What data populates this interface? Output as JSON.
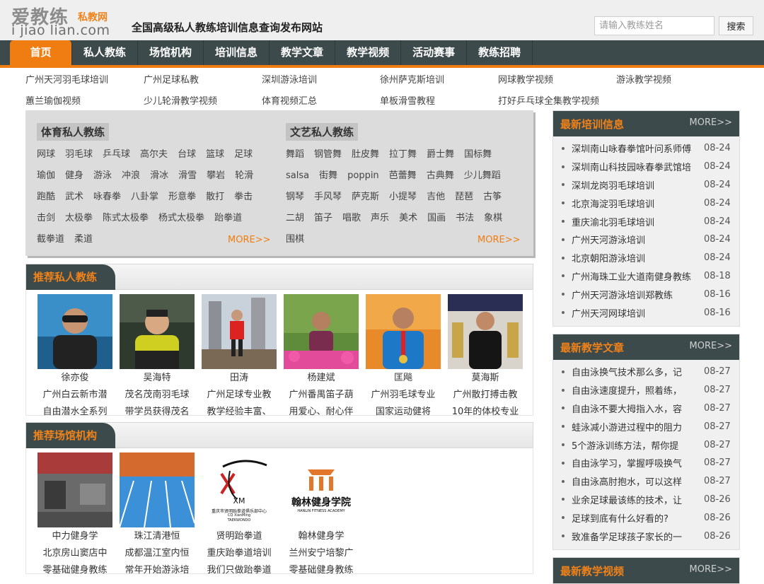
{
  "header": {
    "logo_cn": "爱教练",
    "logo_sub": "私教网",
    "logo_url": "i jiao lian.com",
    "slogan": "全国高级私人教练培训信息查询发布网站",
    "search_placeholder": "请输入教练姓名",
    "search_button": "搜索"
  },
  "nav": {
    "items": [
      "首页",
      "私人教练",
      "场馆机构",
      "培训信息",
      "教学文章",
      "教学视频",
      "活动赛事",
      "教练招聘"
    ]
  },
  "hot_links": [
    "广州天河羽毛球培训",
    "广州足球私教",
    "深圳游泳培训",
    "徐州萨克斯培训",
    "网球教学视频",
    "游泳教学视频",
    "蕙兰瑜伽视频",
    "少儿轮滑教学视频",
    "体育视频汇总",
    "单板滑雪教程",
    "打好乒乓球全集教学视频"
  ],
  "sports": {
    "title": "体育私人教练",
    "tags": [
      "网球",
      "羽毛球",
      "乒乓球",
      "高尔夫",
      "台球",
      "篮球",
      "足球",
      "瑜伽",
      "健身",
      "游泳",
      "冲浪",
      "滑冰",
      "滑雪",
      "攀岩",
      "轮滑",
      "跑酷",
      "武术",
      "咏春拳",
      "八卦掌",
      "形意拳",
      "散打",
      "拳击",
      "击剑",
      "太极拳",
      "陈式太极拳",
      "杨式太极拳",
      "跆拳道",
      "截拳道",
      "柔道"
    ],
    "more": "MORE>>"
  },
  "arts": {
    "title": "文艺私人教练",
    "tags": [
      "舞蹈",
      "钢管舞",
      "肚皮舞",
      "拉丁舞",
      "爵士舞",
      "国标舞",
      "salsa",
      "街舞",
      "poppin",
      "芭蕾舞",
      "古典舞",
      "少儿舞蹈",
      "钢琴",
      "手风琴",
      "萨克斯",
      "小提琴",
      "吉他",
      "琵琶",
      "古筝",
      "二胡",
      "笛子",
      "唱歌",
      "声乐",
      "美术",
      "国画",
      "书法",
      "象棋",
      "围棋"
    ],
    "more": "MORE>>"
  },
  "coaches": {
    "title": "推荐私人教练",
    "items": [
      {
        "name": "徐亦俊",
        "line1": "广州白云新市潜",
        "line2": "自由潜水全系列"
      },
      {
        "name": "吴海特",
        "line1": "茂名茂南羽毛球",
        "line2": "带学员获得茂名"
      },
      {
        "name": "田涛",
        "line1": "广州足球专业教",
        "line2": "教学经验丰富、"
      },
      {
        "name": "杨建斌",
        "line1": "广州番禺笛子葫",
        "line2": "用爱心、耐心伴"
      },
      {
        "name": "匡飚",
        "line1": "广州羽毛球专业",
        "line2": "国家运动健将"
      },
      {
        "name": "莫海斯",
        "line1": "广州散打搏击教",
        "line2": "10年的体校专业"
      }
    ]
  },
  "venues": {
    "title": "推荐场馆机构",
    "items": [
      {
        "name": "中力健身学",
        "line1": "北京房山窦店中",
        "line2": "零基础健身教练"
      },
      {
        "name": "珠江清港恒",
        "line1": "成都温江室内恒",
        "line2": "常年开始游泳培"
      },
      {
        "name": "贤明跆拳道",
        "line1": "重庆跆拳道培训",
        "line2": "我们只做跆拳道"
      },
      {
        "name": "翰林健身学",
        "line1": "兰州安宁培黎广",
        "line2": "零基础健身教练"
      }
    ],
    "logo_xm": "XM",
    "logo_xm_sub": "重庆市贤明跆拳道俱乐部中心",
    "logo_xm_en": "CQ XianMing",
    "logo_xm_en2": "TAEKWONDO",
    "logo_hl": "翰林健身学院",
    "logo_hl_en": "HANLIN FITNESS ACADEMY"
  },
  "training": {
    "title": "最新培训信息",
    "more": "MORE>>",
    "rows": [
      {
        "text": "深圳南山咏春拳馆叶问系师傅",
        "date": "08-24"
      },
      {
        "text": "深圳南山科技园咏春拳武馆培",
        "date": "08-24"
      },
      {
        "text": "深圳龙岗羽毛球培训",
        "date": "08-24"
      },
      {
        "text": "北京海淀羽毛球培训",
        "date": "08-24"
      },
      {
        "text": "重庆渝北羽毛球培训",
        "date": "08-24"
      },
      {
        "text": "广州天河游泳培训",
        "date": "08-24"
      },
      {
        "text": "北京朝阳游泳培训",
        "date": "08-24"
      },
      {
        "text": "广州海珠工业大道南健身教练",
        "date": "08-18"
      },
      {
        "text": "广州天河游泳培训郑教练",
        "date": "08-16"
      },
      {
        "text": "广州天河网球培训",
        "date": "08-16"
      }
    ]
  },
  "articles": {
    "title": "最新教学文章",
    "more": "MORE>>",
    "rows": [
      {
        "text": "自由泳换气技术那么多，记",
        "date": "08-27"
      },
      {
        "text": "自由泳速度提升，照着练，",
        "date": "08-27"
      },
      {
        "text": "自由泳不要大拇指入水，容",
        "date": "08-27"
      },
      {
        "text": "蛙泳减小游进过程中的阻力",
        "date": "08-27"
      },
      {
        "text": "5个游泳训练方法，帮你提",
        "date": "08-27"
      },
      {
        "text": "自由泳学习，掌握呼吸换气",
        "date": "08-27"
      },
      {
        "text": "自由泳高肘抱水，可以这样",
        "date": "08-27"
      },
      {
        "text": "业余足球最该练的技术，让",
        "date": "08-26"
      },
      {
        "text": "足球到底有什么好看的?",
        "date": "08-26"
      },
      {
        "text": "致准备学足球孩子家长的一",
        "date": "08-26"
      }
    ]
  },
  "videos": {
    "title": "最新教学视频",
    "more": "MORE>>"
  },
  "colors": {
    "accent": "#f07d12",
    "nav_bg": "#3c4a4b"
  }
}
